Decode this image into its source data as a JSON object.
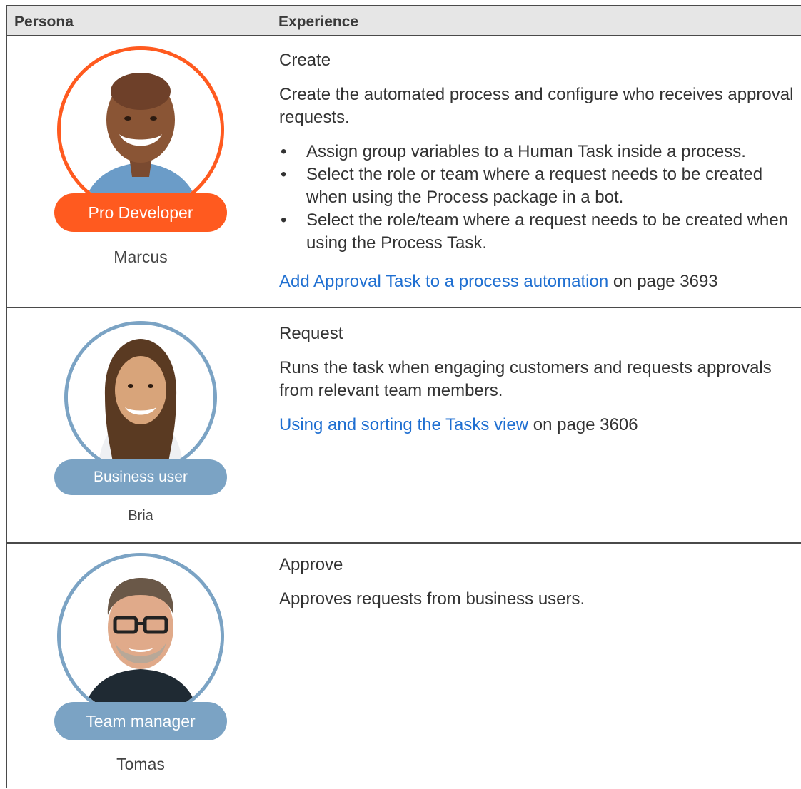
{
  "header": {
    "col1": "Persona",
    "col2": "Experience"
  },
  "rows": [
    {
      "badge": "Pro Developer",
      "name": "Marcus",
      "heading": "Create",
      "description": "Create the automated process and configure who receives approval requests.",
      "bullets": [
        "Assign group variables to a Human Task inside a process.",
        "Select the role or team where a request needs to be created when using the Process package in a bot.",
        "Select the role/team where a request needs to be created when using the Process Task."
      ],
      "link_text": "Add Approval Task to a process automation",
      "link_suffix": " on page 3693",
      "accent": "#ff5a1f"
    },
    {
      "badge": "Business user",
      "name": "Bria",
      "heading": "Request",
      "description": "Runs the task when engaging customers and requests approvals from relevant team members.",
      "link_text": "Using and sorting the Tasks view",
      "link_suffix": " on page 3606",
      "accent": "#7ba3c4"
    },
    {
      "badge": "Team manager",
      "name": "Tomas",
      "heading": "Approve",
      "description": "Approves requests from business users.",
      "accent": "#7ba3c4"
    }
  ]
}
